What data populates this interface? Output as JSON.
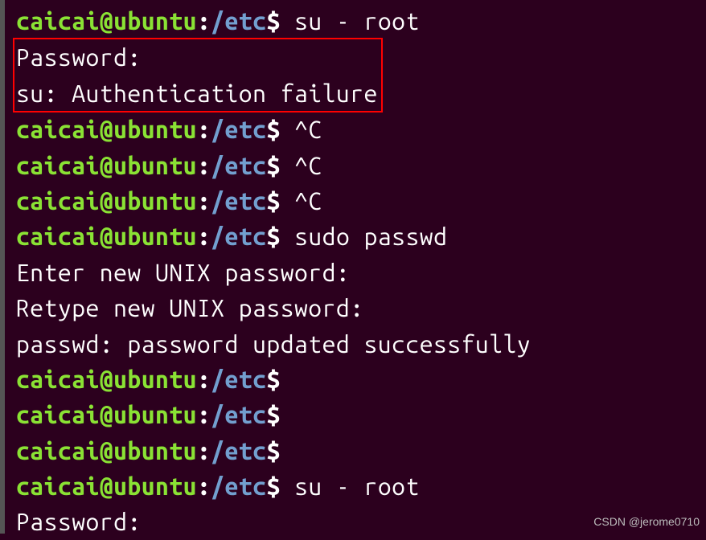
{
  "prompt": {
    "user": "caicai",
    "at": "@",
    "host": "ubuntu",
    "colon": ":",
    "path": "/etc",
    "dollar": "$"
  },
  "lines": {
    "l1_cmd": " su - root",
    "l2": "Password:",
    "l3": "su: Authentication failure",
    "l4_cmd": " ^C",
    "l5_cmd": " ^C",
    "l6_cmd": " ^C",
    "l7_cmd": " sudo passwd",
    "l8": "Enter new UNIX password:",
    "l9": "Retype new UNIX password:",
    "l10": "passwd: password updated successfully",
    "l11_cmd": "",
    "l12_cmd": "",
    "l13_cmd": "",
    "l14_cmd": " su - root",
    "l15": "Password:"
  },
  "watermark": "CSDN @jerome0710"
}
